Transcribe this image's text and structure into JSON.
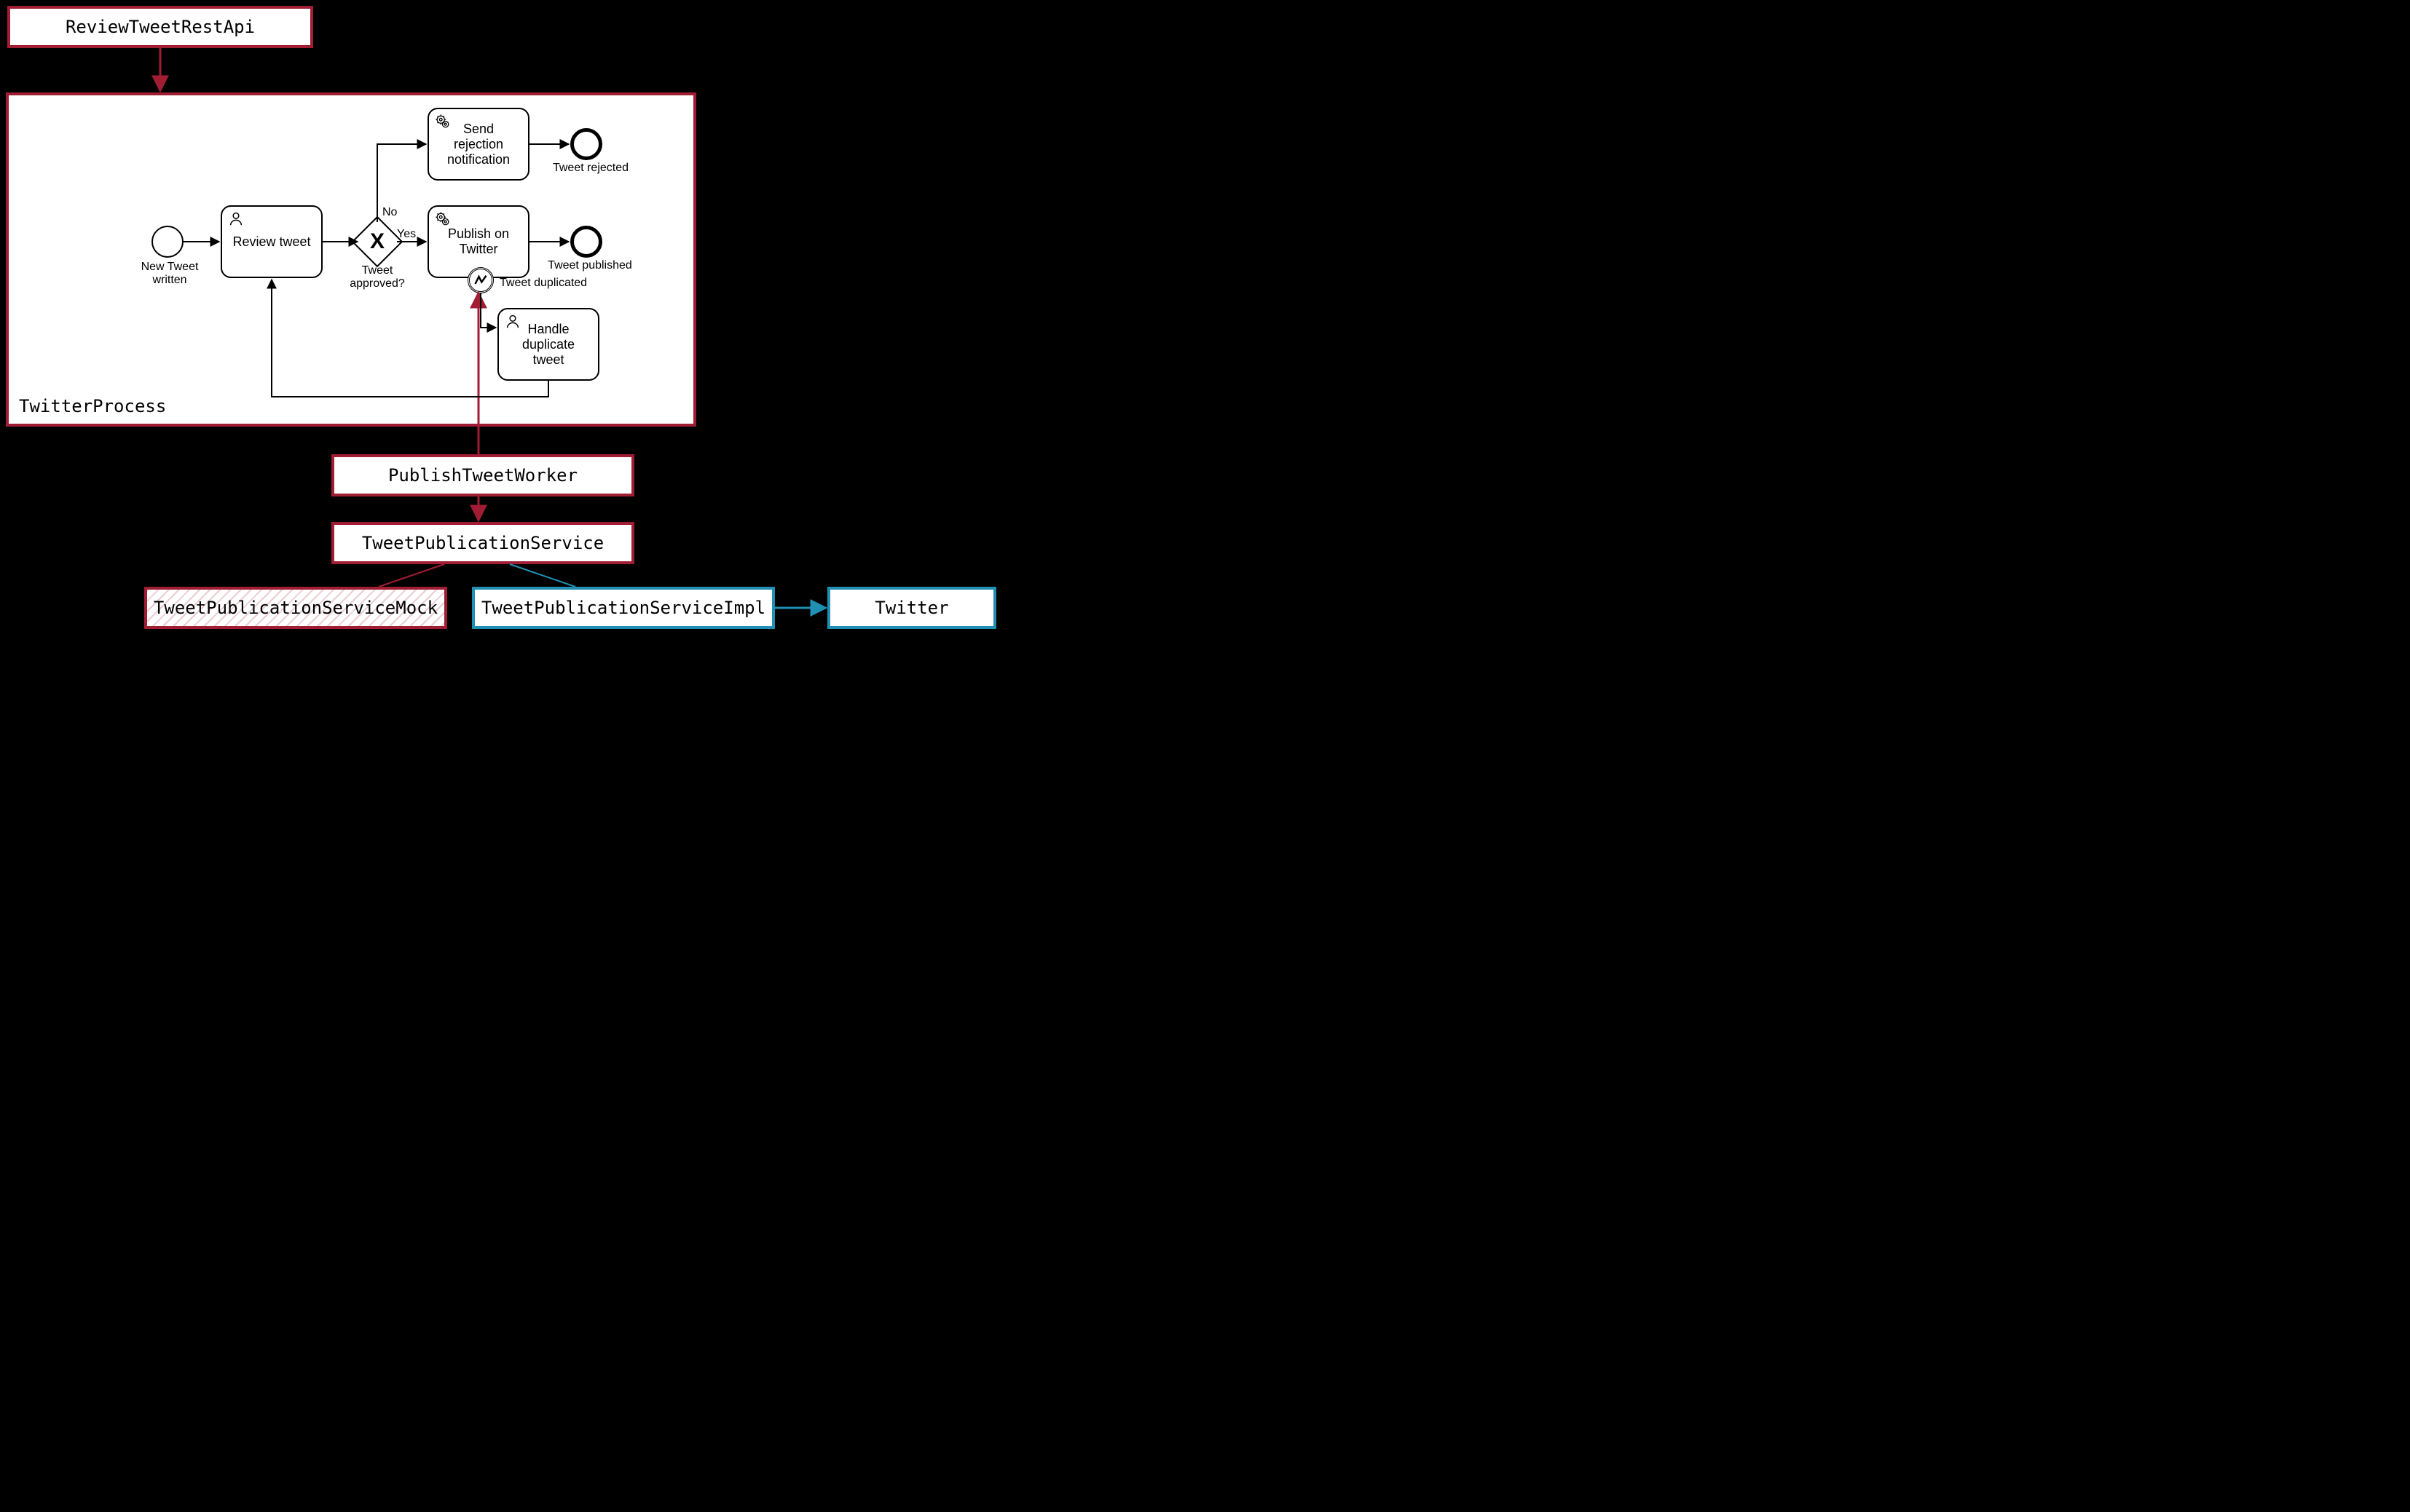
{
  "components": {
    "rest_api": "ReviewTweetRestApi",
    "worker": "PublishTweetWorker",
    "service": "TweetPublicationService",
    "service_mock": "TweetPublicationServiceMock",
    "service_impl": "TweetPublicationServiceImpl",
    "external": "Twitter"
  },
  "process": {
    "name": "TwitterProcess",
    "start_event": "New Tweet written",
    "user_task_review": "Review tweet",
    "gateway_label": "Tweet approved?",
    "gateway_no": "No",
    "gateway_yes": "Yes",
    "service_task_reject": "Send rejection notification",
    "service_task_publish": "Publish on Twitter",
    "end_rejected": "Tweet rejected",
    "end_published": "Tweet published",
    "boundary_event": "Tweet duplicated",
    "user_task_duplicate": "Handle duplicate tweet"
  },
  "colors": {
    "red": "#a11d33",
    "blue": "#1f8fb4",
    "black": "#000000"
  }
}
